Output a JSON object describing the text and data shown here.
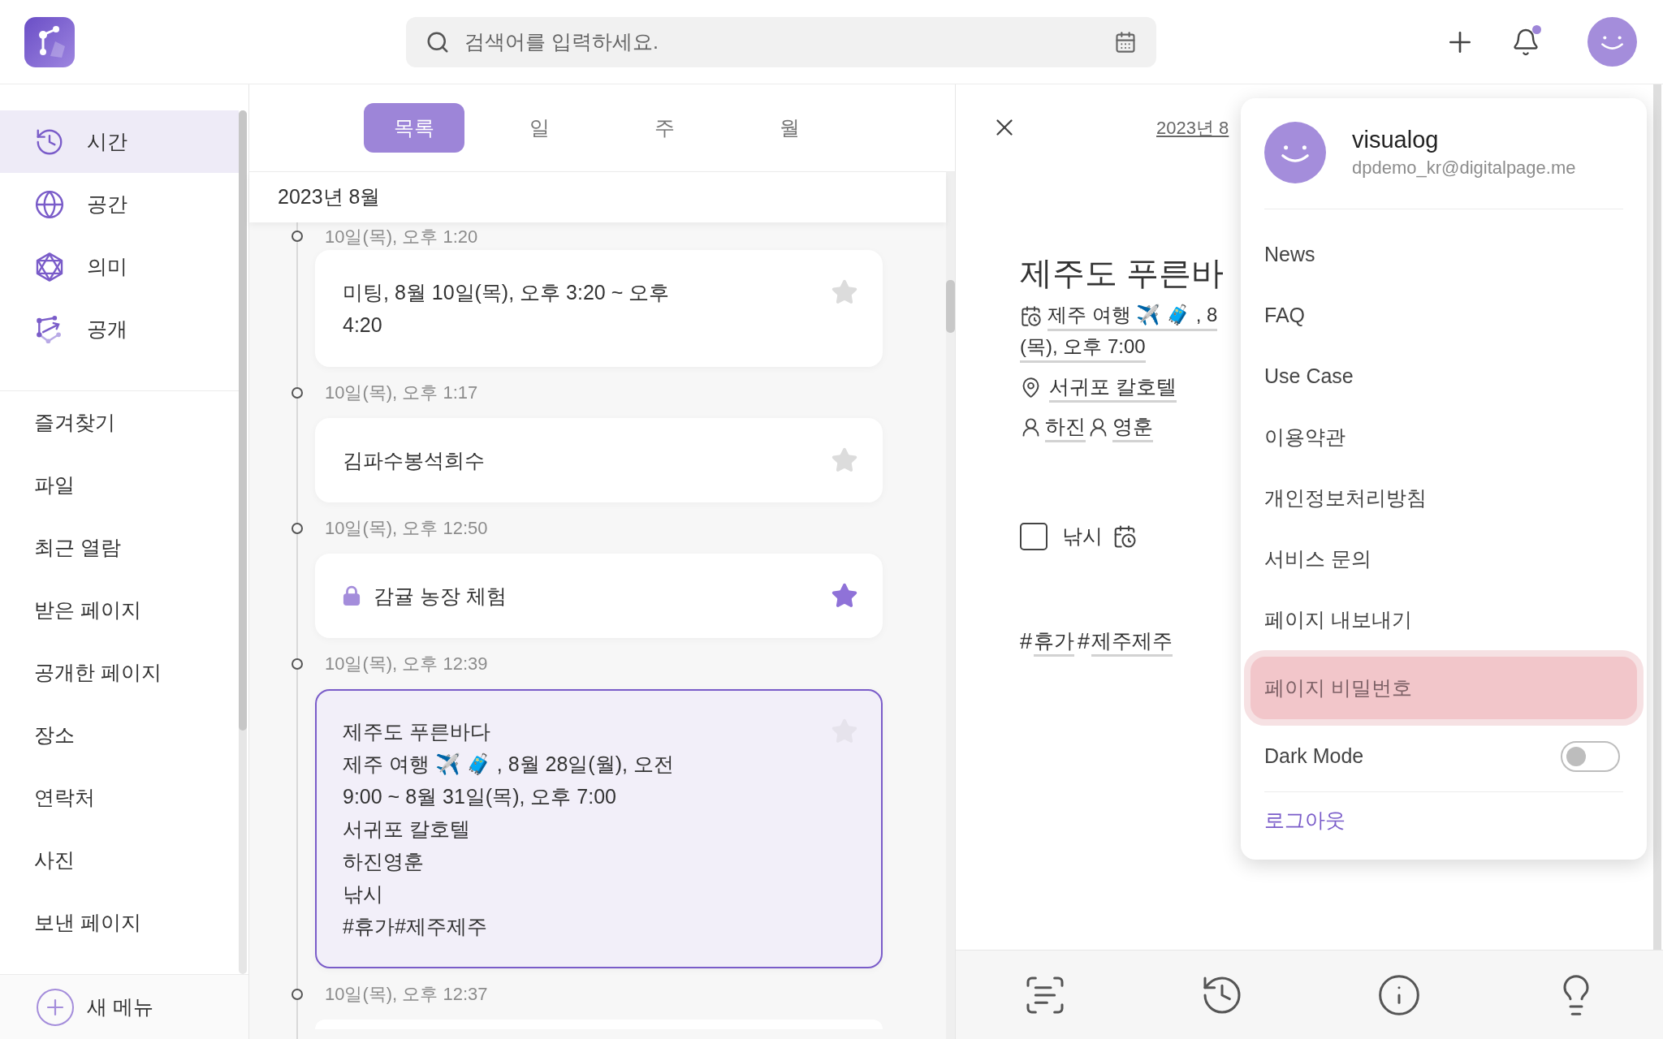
{
  "header": {
    "search": {
      "placeholder": "검색어를 입력하세요."
    },
    "notifications": {
      "unread": true
    }
  },
  "sidebar": {
    "nav": [
      {
        "label": "시간",
        "selected": true
      },
      {
        "label": "공간",
        "selected": false
      },
      {
        "label": "의미",
        "selected": false
      },
      {
        "label": "공개",
        "selected": false
      }
    ],
    "items": [
      {
        "label": "즐겨찾기"
      },
      {
        "label": "파일"
      },
      {
        "label": "최근 열람"
      },
      {
        "label": "받은 페이지"
      },
      {
        "label": "공개한 페이지"
      },
      {
        "label": "장소"
      },
      {
        "label": "연락처"
      },
      {
        "label": "사진"
      },
      {
        "label": "보낸 페이지"
      }
    ],
    "new_menu": {
      "label": "새 메뉴"
    }
  },
  "list": {
    "tabs": [
      {
        "label": "목록",
        "selected": true
      },
      {
        "label": "일",
        "selected": false
      },
      {
        "label": "주",
        "selected": false
      },
      {
        "label": "월",
        "selected": false
      }
    ],
    "month": "2023년 8월",
    "entries": [
      {
        "time": "10일(목), 오후 1:20",
        "lines": [
          "미팅, 8월 10일(목), 오후 3:20 ~ 오후 4:20"
        ],
        "locked": false,
        "starred": false,
        "selected": false
      },
      {
        "time": "10일(목), 오후 1:17",
        "lines": [
          "김파수봉석희수"
        ],
        "locked": false,
        "starred": false,
        "selected": false
      },
      {
        "time": "10일(목), 오후 12:50",
        "lines": [
          "감귤 농장 체험"
        ],
        "locked": true,
        "starred": true,
        "selected": false
      },
      {
        "time": "10일(목), 오후 12:39",
        "lines": [
          "제주도 푸른바다",
          "제주 여행 ✈️ 🧳 , 8월 28일(월), 오전 9:00 ~ 8월 31일(목), 오후 7:00",
          "서귀포 칼호텔",
          "하진영훈",
          "낚시",
          "#휴가#제주제주"
        ],
        "locked": false,
        "starred": false,
        "selected": true
      },
      {
        "time": "10일(목), 오후 12:37"
      }
    ]
  },
  "detail": {
    "date": "2023년 8",
    "title": "제주도 푸른바",
    "schedule": [
      "제주 여행 ✈️ 🧳 , 8",
      "(목), 오후 7:00"
    ],
    "place": "서귀포 칼호텔",
    "people": [
      "하진",
      "영훈"
    ],
    "todo": {
      "label": "낚시",
      "checked": false
    },
    "tags": [
      {
        "hash": "#",
        "label": "휴가"
      },
      {
        "hash": "#",
        "label": "제주제주"
      }
    ]
  },
  "account_menu": {
    "name": "visualog",
    "email": "dpdemo_kr@digitalpage.me",
    "items": [
      {
        "label": "News",
        "kind": "link",
        "highlighted": false
      },
      {
        "label": "FAQ",
        "kind": "link",
        "highlighted": false
      },
      {
        "label": "Use Case",
        "kind": "link",
        "highlighted": false
      },
      {
        "label": "이용약관",
        "kind": "link",
        "highlighted": false
      },
      {
        "label": "개인정보처리방침",
        "kind": "link",
        "highlighted": false
      },
      {
        "label": "서비스 문의",
        "kind": "link",
        "highlighted": false
      },
      {
        "label": "페이지 내보내기",
        "kind": "link",
        "highlighted": false
      },
      {
        "label": "페이지 비밀번호",
        "kind": "link",
        "highlighted": true
      },
      {
        "label": "Dark Mode",
        "kind": "toggle",
        "on": false,
        "highlighted": false
      },
      {
        "label": "로그아웃",
        "kind": "logout",
        "highlighted": false
      }
    ]
  }
}
